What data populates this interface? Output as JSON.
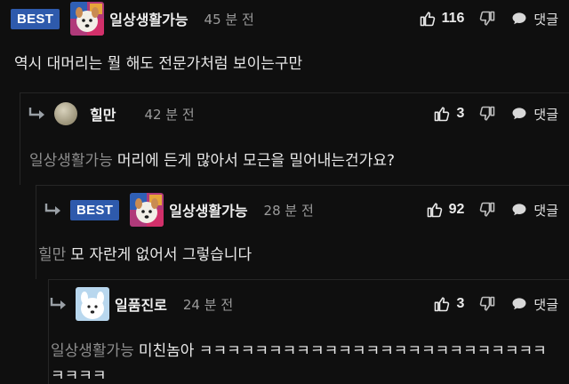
{
  "labels": {
    "best": "BEST",
    "reply": "댓글"
  },
  "colors": {
    "background": "#0f0f0f",
    "best_badge": "#2e5aac",
    "mention": "#8d8d8d"
  },
  "comments": [
    {
      "author": "일상생활가능",
      "time": "45 분 전",
      "likes": "116",
      "text": "역시 대머리는 뭘 해도 전문가처럼 보이는구만"
    },
    {
      "author": "힐만",
      "time": "42 분 전",
      "likes": "3",
      "mention": "일상생활가능",
      "text": "머리에 든게 많아서 모근을 밀어내는건가요?"
    },
    {
      "author": "일상생활가능",
      "time": "28 분 전",
      "likes": "92",
      "mention": "힐만",
      "text": "모 자란게 없어서 그렇습니다"
    },
    {
      "author": "일품진로",
      "time": "24 분 전",
      "likes": "3",
      "mention": "일상생활가능",
      "text": "미친놈아 ㅋㅋㅋㅋㅋㅋㅋㅋㅋㅋㅋㅋㅋㅋㅋㅋㅋㅋㅋㅋㅋㅋㅋㅋㅋㅋㅋㅋㅋ"
    }
  ],
  "icons": {
    "like": "thumbs-up-icon",
    "dislike": "thumbs-down-icon",
    "reply": "speech-bubble-icon",
    "nested": "reply-arrow-icon"
  }
}
